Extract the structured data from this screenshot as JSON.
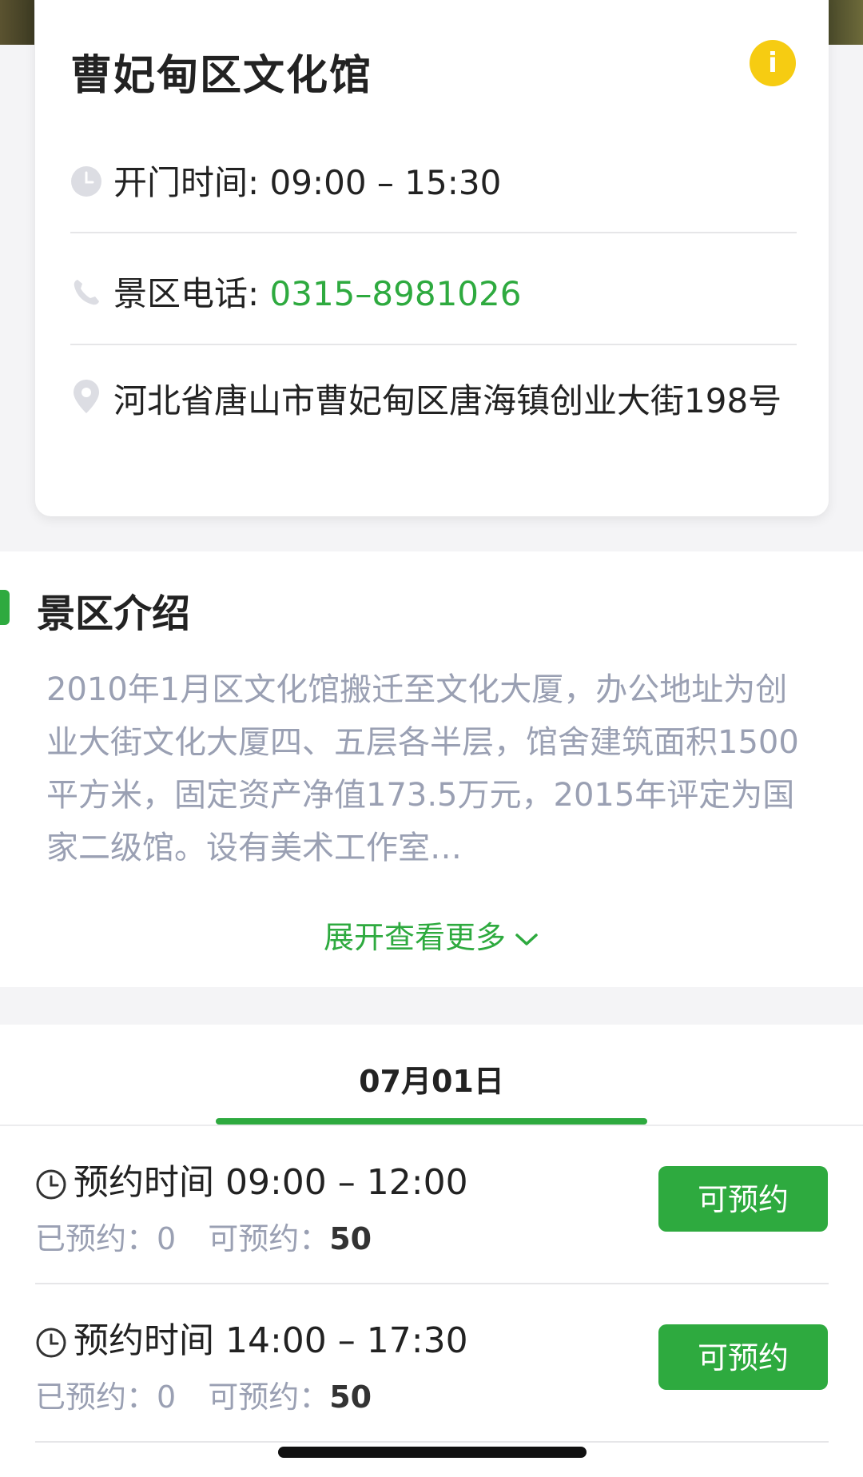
{
  "venue": {
    "name": "曹妃甸区文化馆",
    "hours_label": "开门时间: ",
    "hours_value": "09:00 – 15:30",
    "phone_label": "景区电话: ",
    "phone_value": "0315–8981026",
    "address": "河北省唐山市曹妃甸区唐海镇创业大街198号",
    "info_icon_text": "i",
    "colors": {
      "info_badge": "#f6cc12",
      "accent": "#2eaa3f"
    }
  },
  "intro": {
    "title": "景区介绍",
    "text": "2010年1月区文化馆搬迁至文化大厦，办公地址为创业大街文化大厦四、五层各半层，馆舍建筑面积1500平方米，固定资产净值173.5万元，2015年评定为国家二级馆。设有美术工作室…",
    "expand_label": "展开查看更多"
  },
  "booking": {
    "date_tab": "07月01日",
    "slots": [
      {
        "label": "预约时间 09:00 – 12:00",
        "booked_label": "已预约：",
        "booked": "0",
        "available_label": "可预约：",
        "available": "50",
        "button": "可预约"
      },
      {
        "label": "预约时间 14:00 – 17:30",
        "booked_label": "已预约：",
        "booked": "0",
        "available_label": "可预约：",
        "available": "50",
        "button": "可预约"
      }
    ]
  },
  "icons": [
    "clock-icon",
    "phone-icon",
    "location-pin-icon",
    "info-icon",
    "chevron-down-icon"
  ]
}
